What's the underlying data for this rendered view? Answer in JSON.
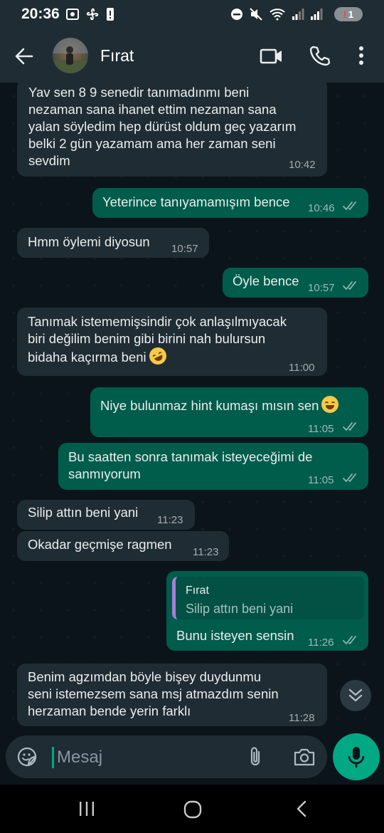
{
  "status_bar": {
    "time": "20:36",
    "notification_count": "1"
  },
  "header": {
    "contact_name": "Fırat"
  },
  "messages": [
    {
      "direction": "in",
      "text": "Yav sen 8 9 senedir tanımadınmı beni\nnezaman sana ihanet ettim nezaman sana\nyalan söyledim hep dürüst oldum geç yazarım\nbelki 2 gün yazamam ama her zaman seni\nsevdim",
      "time": "10:42"
    },
    {
      "direction": "out",
      "text": "Yeterince tanıyamamışım bence",
      "time": "10:46",
      "status": "read"
    },
    {
      "direction": "in",
      "text": "Hmm öylemi diyosun",
      "time": "10:57"
    },
    {
      "direction": "out",
      "text": "Öyle bence",
      "time": "10:57",
      "status": "read"
    },
    {
      "direction": "in",
      "text": "Tanımak istememişsindir çok anlaşılmıyacak\nbiri değilim benim gibi birini nah bulursun\nbidaha kaçırma beni",
      "time": "11:00",
      "emoji": "rolling-on-floor-laughing"
    },
    {
      "direction": "out",
      "text": "Niye bulunmaz hint kumaşı mısın sen",
      "time": "11:05",
      "status": "read",
      "emoji": "tears-of-joy"
    },
    {
      "direction": "out",
      "text": "Bu saatten sonra tanımak isteyeceğimi de\nsanmıyorum",
      "time": "11:05",
      "status": "read"
    },
    {
      "direction": "in",
      "text": "Silip attın beni yani",
      "time": "11:23"
    },
    {
      "direction": "in",
      "text": "Okadar geçmişe ragmen",
      "time": "11:23"
    },
    {
      "direction": "out",
      "text": "Bunu isteyen sensin",
      "time": "11:26",
      "status": "read",
      "reply_to": {
        "name": "Fırat",
        "text": "Silip attın beni yani"
      }
    },
    {
      "direction": "in",
      "text": "Benim agzımdan böyle bişey duydunmu\nseni istemezsem sana msj atmazdım senin\nherzaman bende yerin farklı",
      "time": "11:28"
    }
  ],
  "composer": {
    "placeholder": "Mesaj"
  },
  "colors": {
    "background": "#0b141a",
    "header": "#1f2c34",
    "incoming_bubble": "#202c33",
    "outgoing_bubble": "#005c4b",
    "accent": "#00a884",
    "read_ticks": "#8fb8ad"
  }
}
